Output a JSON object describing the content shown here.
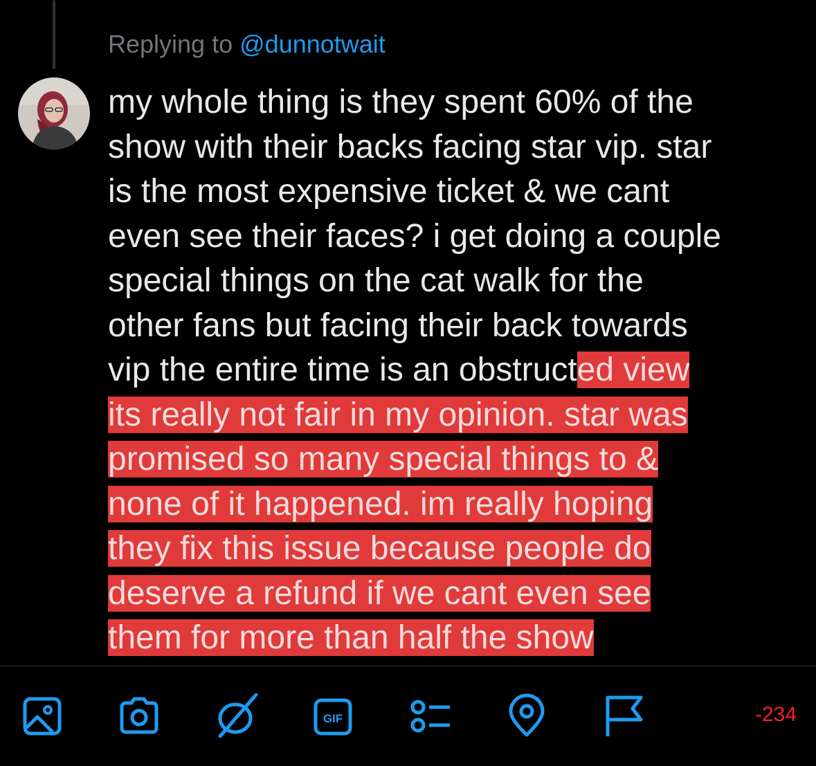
{
  "reply": {
    "prefix": "Replying to",
    "handle": "@dunnotwait"
  },
  "tweet": {
    "lines": [
      "my whole thing is they spent 60% of the",
      "show with their backs facing star vip. star",
      "is the most expensive ticket & we cant",
      "even see their faces? i get doing a couple",
      "special things on the cat walk for the",
      "other fans but facing their back towards"
    ],
    "line7_plain": "vip the entire time is an obstruct",
    "line7_highlighted": "ed view",
    "highlighted_lines": [
      "its really not fair in my opinion. star was",
      "promised so many special things to &",
      "none of it happened. im really hoping",
      "they fix this issue because people do",
      "deserve a refund if we cant even see",
      "them for more than half the show"
    ]
  },
  "toolbar": {
    "icons": [
      "image-icon",
      "camera-icon",
      "ai-sparkle-icon",
      "gif-icon",
      "poll-icon",
      "location-icon",
      "flag-icon"
    ],
    "gif_label": "GIF",
    "accent_color": "#1d9bf0"
  },
  "char_counter": "-234",
  "colors": {
    "background": "#000000",
    "text": "#e7e9ea",
    "muted": "#71767b",
    "highlight": "#e03a3a",
    "counter": "#f4212e"
  }
}
